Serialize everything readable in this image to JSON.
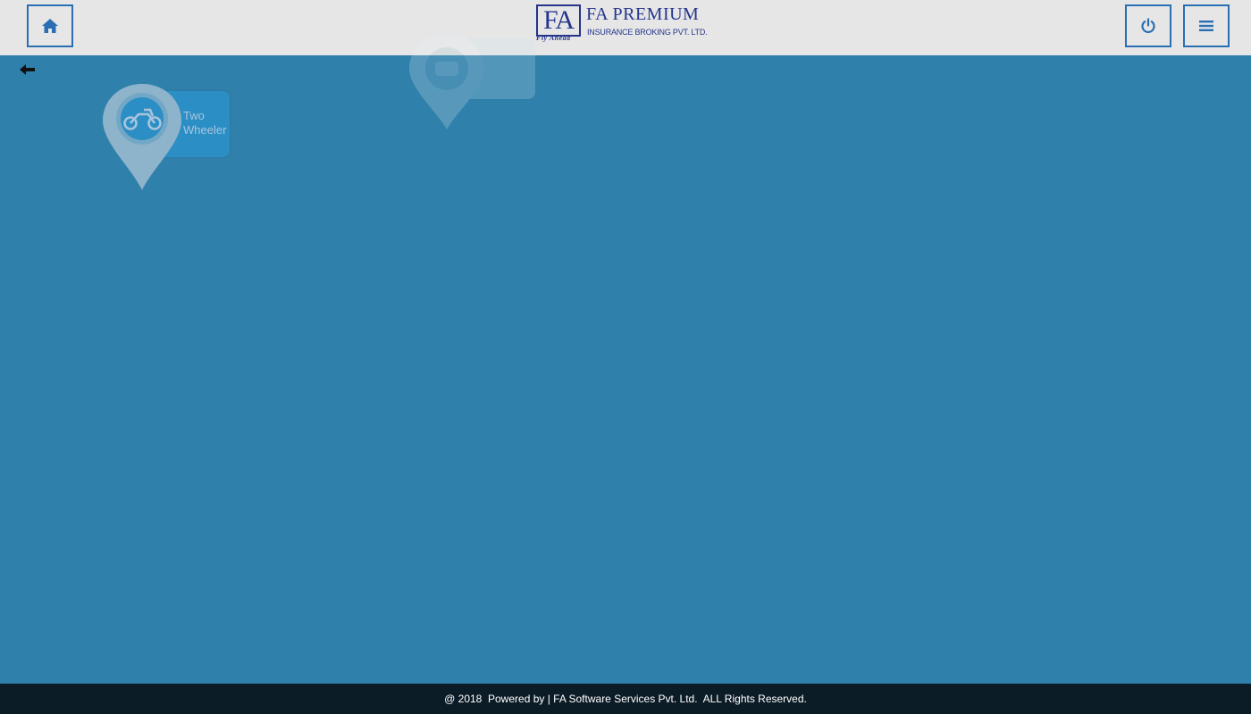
{
  "header": {
    "home_icon": "home-icon",
    "power_icon": "power-icon",
    "menu_icon": "menu-icon",
    "logo": {
      "mark": "FA",
      "tagline": "Fly Ahead",
      "brand": "FA PREMIUM",
      "subtitle": "INSURANCE BROKING PVT. LTD."
    }
  },
  "nav": {
    "back_icon": "arrow-left-icon"
  },
  "categories": [
    {
      "label": "Two Wheeler",
      "icon": "motorcycle-icon"
    }
  ],
  "footer": {
    "text": "@ 2018  Powered by | FA Software Services Pvt. Ltd.  ALL Rights Reserved."
  },
  "colors": {
    "background": "#2f80ab",
    "header": "#e6e6e6",
    "accent": "#2a6fb4",
    "logo": "#25358c",
    "footer": "#0c1c26"
  }
}
